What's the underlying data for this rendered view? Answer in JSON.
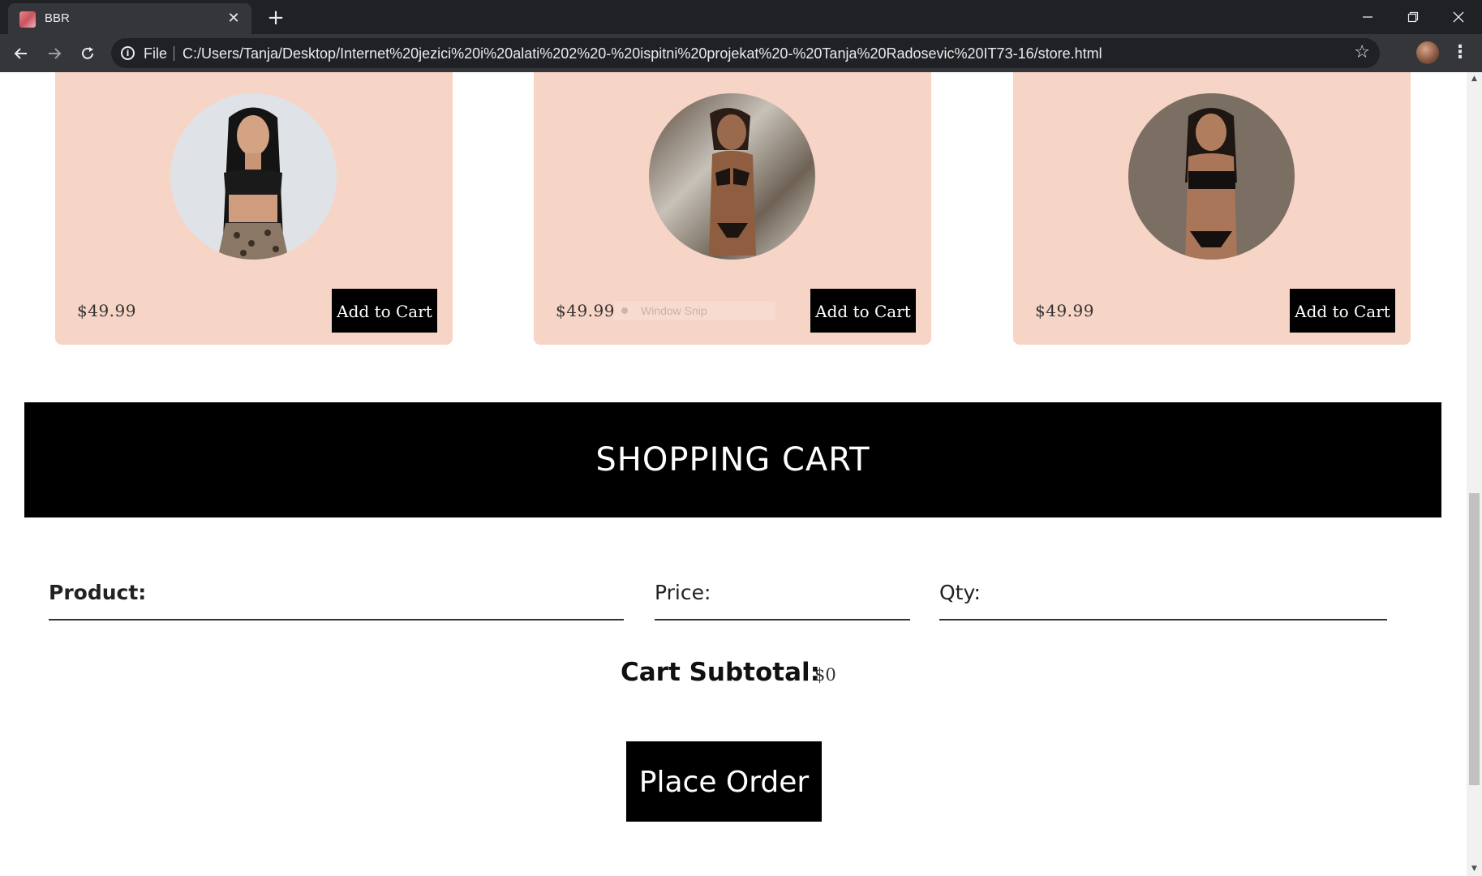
{
  "browser": {
    "tab_title": "BBR",
    "tab_close": "✕",
    "new_tab": "+",
    "scheme_label": "File",
    "url": "C:/Users/Tanja/Desktop/Internet%20jezici%20i%20alati%202%20-%20ispitni%20projekat%20-%20Tanja%20Radosevic%20IT73-16/store.html",
    "icons": [
      "back-icon",
      "forward-icon",
      "reload-icon",
      "info-icon",
      "star-icon",
      "menu-icon"
    ]
  },
  "products": [
    {
      "price": "$49.99",
      "button": "Add to Cart"
    },
    {
      "price": "$49.99",
      "button": "Add to Cart"
    },
    {
      "price": "$49.99",
      "button": "Add to Cart"
    }
  ],
  "overlay": {
    "snip_label": "Window Snip"
  },
  "cart": {
    "title": "SHOPPING CART",
    "columns": {
      "product": "Product:",
      "price": "Price:",
      "qty": "Qty:"
    },
    "subtotal_label": "Cart Subtotal:",
    "subtotal_value": "$0",
    "place_order": "Place Order"
  },
  "colors": {
    "card_bg": "#f6d4c6",
    "button_bg": "#000000",
    "chrome_dark": "#202124",
    "chrome_toolbar": "#35363a"
  }
}
